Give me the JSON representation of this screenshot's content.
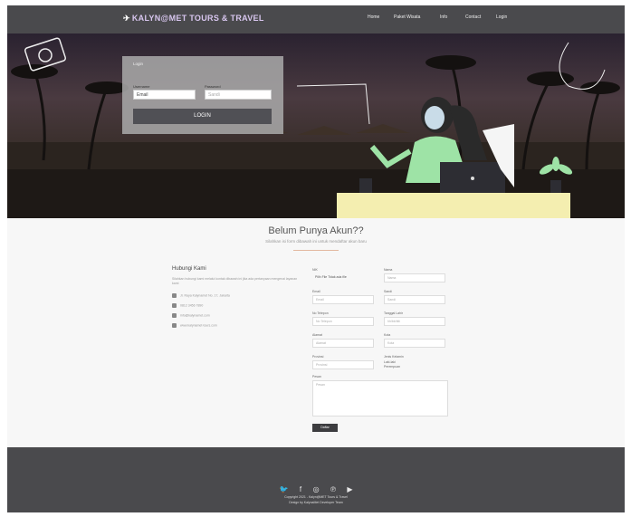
{
  "nav": {
    "brand": "KALYN@MET TOURS & TRAVEL",
    "items": [
      {
        "label": "Home"
      },
      {
        "label": "Paket Wisata"
      },
      {
        "label": "Info"
      },
      {
        "label": "Contact"
      },
      {
        "label": "Login"
      }
    ]
  },
  "login": {
    "title": "Login",
    "username_label": "Username",
    "username_value": "Email",
    "password_label": "Password",
    "password_value": "Sandi",
    "button": "LOGIN"
  },
  "register": {
    "title": "Belum Punya Akun??",
    "subtitle": "Silahkan isi form dibawah ini untuk mendaftar akun baru",
    "contact": {
      "title": "Hubungi Kami",
      "desc": "Silahkan hubungi kami melalui kontak dibawah ini jika ada pertanyaan mengenai layanan kami",
      "address": "Jl. Raya Kalynamet No. 17, Jakarta",
      "phone": "0812 3456 7890",
      "email": "info@kalynamet.com",
      "web": "www.kalynamet-tours.com"
    },
    "fields": {
      "f1_label": "NIK",
      "f1_value": "Pilih File Tidak ada file",
      "f2_label": "Nama",
      "f2_value": "Nama",
      "f3_label": "Email",
      "f3_value": "Email",
      "f4_label": "Sandi",
      "f4_value": "Sandi",
      "f5_label": "No Telepon",
      "f5_value": "No Telepon",
      "f6_label": "Tanggal Lahir",
      "f6_value": "hh/bb/tttt",
      "f7_label": "Alamat",
      "f7_value": "Alamat",
      "f8_label": "Kota",
      "f8_value": "Kota",
      "f9_label": "Provinsi",
      "f9_value": "Provinsi",
      "f10_label": "Jenis Kelamin",
      "f10_opt1": "Laki-laki",
      "f10_opt2": "Perempuan",
      "message_label": "Pesan",
      "message_placeholder": "Pesan"
    },
    "submit": "Daftar"
  },
  "footer": {
    "socials": [
      "twitter-icon",
      "facebook-icon",
      "instagram-icon",
      "pinterest-icon",
      "youtube-icon"
    ],
    "social_glyphs": [
      "🐦",
      "f",
      "◎",
      "℗",
      "▶"
    ],
    "copyright": "Copyright 2021 - Kalyn@MET Tours & Travel",
    "credit": "Design by KalynaMet Developer Team"
  },
  "colors": {
    "nav_bg": "#4a4a4d",
    "brand": "#d8c6ef",
    "desk": "#f4eeb0",
    "footer_bg": "#4a4a4d"
  }
}
